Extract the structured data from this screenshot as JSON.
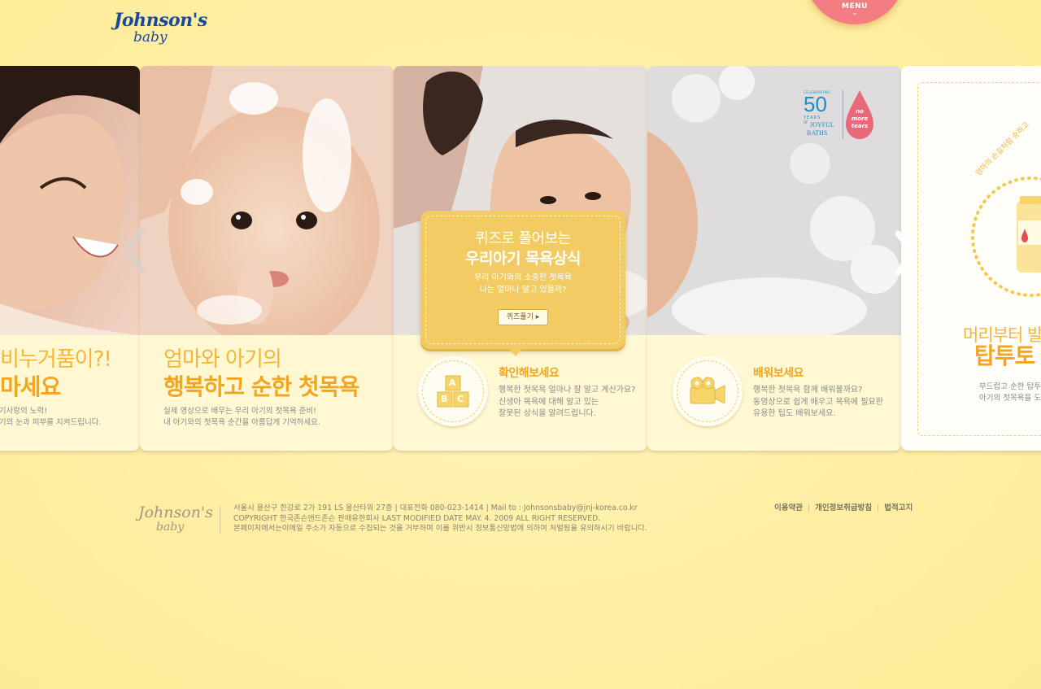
{
  "header": {
    "logo_line1": "Johnson's",
    "logo_line2": "baby",
    "menu_label": "MENU",
    "menu_chevron": "⌄"
  },
  "panels": {
    "panel1": {
      "title_line1": "비누거품이?!",
      "title_line2": "마세요",
      "desc_line1": "아기사랑의 노력!",
      "desc_line2": "아기의 눈과 피부를 지켜드립니다."
    },
    "panel2": {
      "title_line1": "엄마와 아기의",
      "title_line2": "행복하고 순한 첫목욕",
      "desc_line1": "실제 영상으로 배우는 우리 아기의 첫목욕 준비!",
      "desc_line2": "내 아기와의 첫목욕 순간을 아름답게 기억하세요."
    },
    "quiz": {
      "line1": "퀴즈로 풀어보는",
      "line2": "우리아기 목욕상식",
      "line3": "우리 아기와의 소중한 첫목욕",
      "line4": "나는 얼마나 알고 있을까?",
      "button": "퀴즈풀기 ▸"
    },
    "panel3": {
      "title": "확인해보세요",
      "body_line1": "행복한 첫목욕 얼마나 잘 알고 계신가요?",
      "body_line2": "신생아 목욕에 대해 알고 있는",
      "body_line3": "잘못된 상식을 알려드립니다.",
      "blocks": [
        "A",
        "B",
        "C"
      ]
    },
    "panel4": {
      "badge_celebrating": "CELEBRATING",
      "badge_years": "50",
      "badge_years_label": "YEARS",
      "badge_of": "OF",
      "badge_joyful": "JOYFUL",
      "badge_baths": "BATHS",
      "badge_nmt": "no more tears",
      "title": "배워보세요",
      "body_line1": "행복한 첫목욕 함께 배워볼까요?",
      "body_line2": "동영상으로 쉽게 배우고 목욕에 필요한",
      "body_line3": "유용한 팁도 배워보세요."
    },
    "panel5": {
      "arc_text": "엄마의 손길처럼 순하고",
      "title_line1": "머리부터 발",
      "title_line2": "탑투토",
      "desc_line1": "부드럽고 순한 탑투",
      "desc_line2": "아기의 첫목욕을 도"
    }
  },
  "nav": {
    "prev_icon": "chevron-left",
    "next_icon": "chevron-right"
  },
  "footer": {
    "logo_line1": "Johnson's",
    "logo_line2": "baby",
    "info_line1": "서울시 용산구 한강로 2가 191 LS 용산타워 27층  |  대표전화 080-023-1414  |  Mail to : Johnsonsbaby@jnj-korea.co.kr",
    "info_line2": "COPYRIGHT 한국존슨앤드존슨 판매유한회사  LAST MODIFIED DATE MAY. 4. 2009 ALL RIGHT RESERVED.",
    "info_line3": "본페이지에서는이메일 주소가 자동으로 수집되는 것을 거부하며 이를 위반시 정보통신망법에 의하여 처벌됨을 유의하시기 바랍니다.",
    "links": [
      "이용약관",
      "개인정보취급방침",
      "법적고지"
    ]
  },
  "colors": {
    "background": "#fff0a8",
    "accent_orange": "#f2a520",
    "quiz_yellow": "#f2cc62",
    "menu_pink": "#f47c83",
    "brand_blue": "#1b4a9c"
  }
}
